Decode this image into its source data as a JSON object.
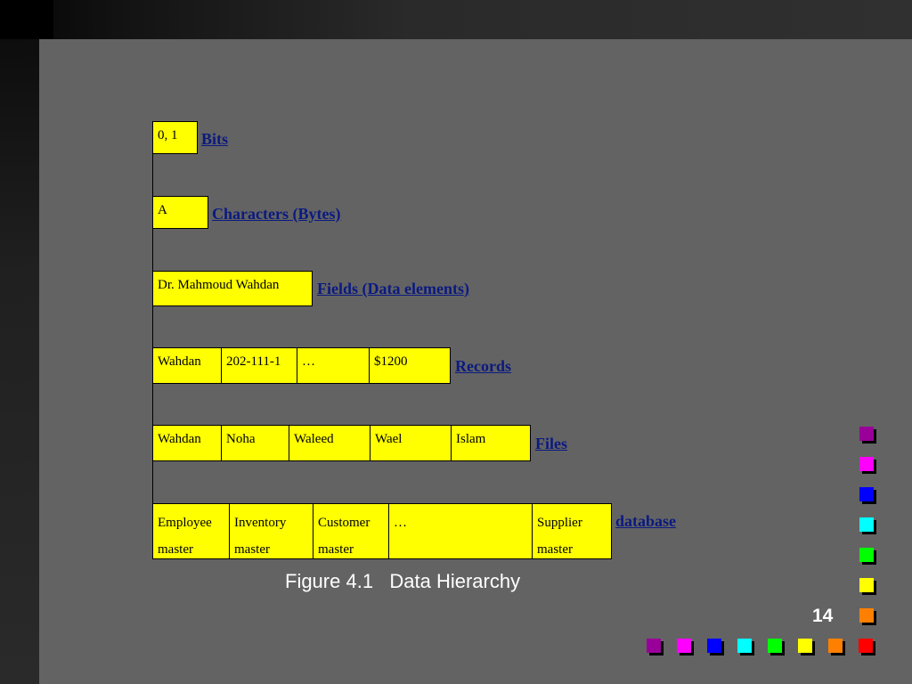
{
  "levels": [
    {
      "label": "Bits",
      "cells": [
        "0, 1"
      ]
    },
    {
      "label": "Characters (Bytes)",
      "cells": [
        "A"
      ]
    },
    {
      "label": "Fields (Data elements)",
      "cells": [
        "Dr. Mahmoud Wahdan"
      ]
    },
    {
      "label": "Records",
      "cells": [
        "Wahdan",
        "202-111-1",
        "…",
        "$1200"
      ]
    },
    {
      "label": "Files",
      "cells": [
        "Wahdan",
        "Noha",
        "Waleed",
        "Wael",
        "Islam"
      ]
    },
    {
      "label": "database",
      "cells": [
        "Employee master",
        "Inventory master",
        "Customer master",
        "…",
        "Supplier master"
      ]
    }
  ],
  "caption": "Figure 4.1   Data Hierarchy",
  "page_number": "14",
  "colors": {
    "cell_fill": "#ffff00",
    "label_text": "#0b1a80",
    "background": "#636363",
    "squares_right": [
      "#990099",
      "#ff00ff",
      "#0000ff",
      "#00ffff",
      "#00ff00",
      "#ffff00",
      "#ff8000"
    ],
    "squares_bottom": [
      "#990099",
      "#ff00ff",
      "#0000ff",
      "#00ffff",
      "#00ff00",
      "#ffff00",
      "#ff8000",
      "#ff0000"
    ]
  }
}
